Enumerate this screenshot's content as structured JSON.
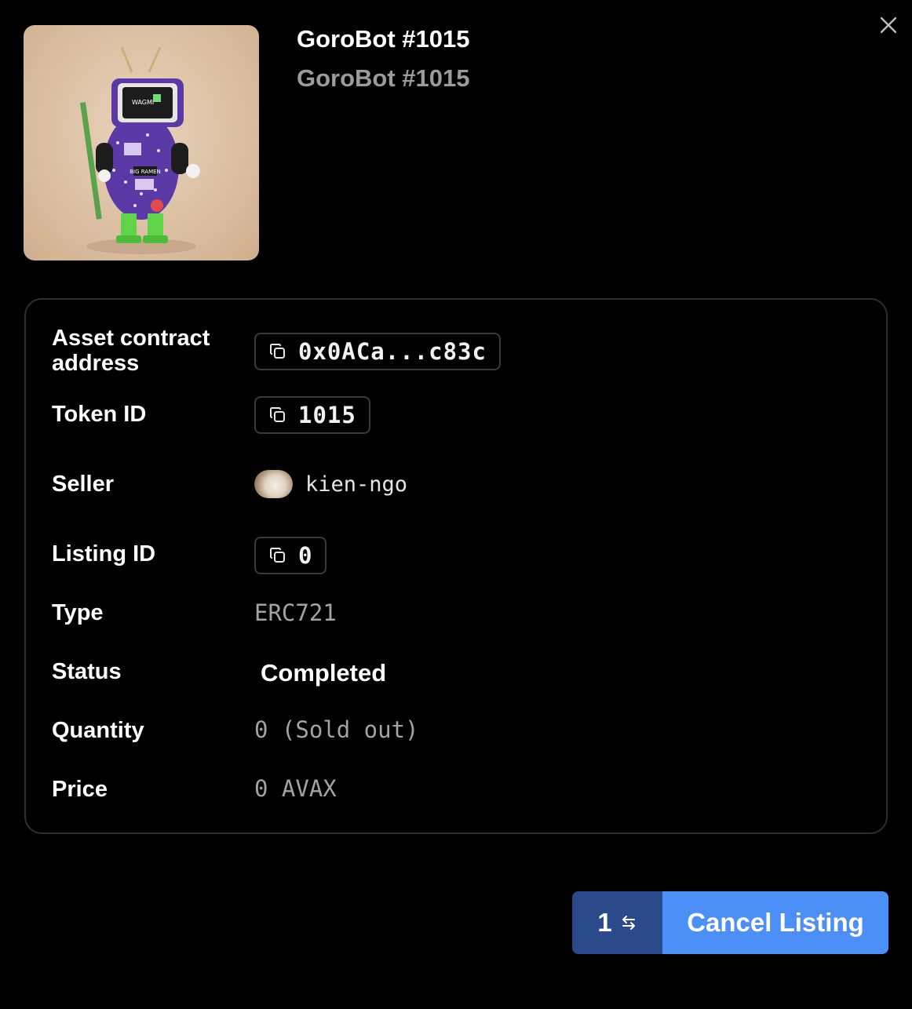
{
  "nft": {
    "name": "GoroBot #1015",
    "collection_line": "GoroBot #1015",
    "image_text": {
      "screen": "WAGMI",
      "belt": "BIG RAMEN"
    }
  },
  "details": {
    "asset_contract": {
      "label": "Asset contract\naddress",
      "value": "0x0ACa...c83c"
    },
    "token_id": {
      "label": "Token ID",
      "value": "1015"
    },
    "seller": {
      "label": "Seller",
      "value": "kien-ngo"
    },
    "listing_id": {
      "label": "Listing ID",
      "value": "0"
    },
    "type": {
      "label": "Type",
      "value": "ERC721"
    },
    "status": {
      "label": "Status",
      "value": "Completed"
    },
    "quantity": {
      "label": "Quantity",
      "value": "0 (Sold out)"
    },
    "price": {
      "label": "Price",
      "value": "0 AVAX"
    }
  },
  "actions": {
    "count": "1",
    "cancel_label": "Cancel Listing"
  },
  "icons": {
    "close": "close-icon",
    "copy": "copy-icon",
    "switch": "switch-icon"
  },
  "colors": {
    "background": "#000000",
    "primary_button": "#4b8ff7",
    "secondary_button": "#2a4a8c",
    "border": "#2e2e2e",
    "muted_text": "#a3a3a3"
  }
}
